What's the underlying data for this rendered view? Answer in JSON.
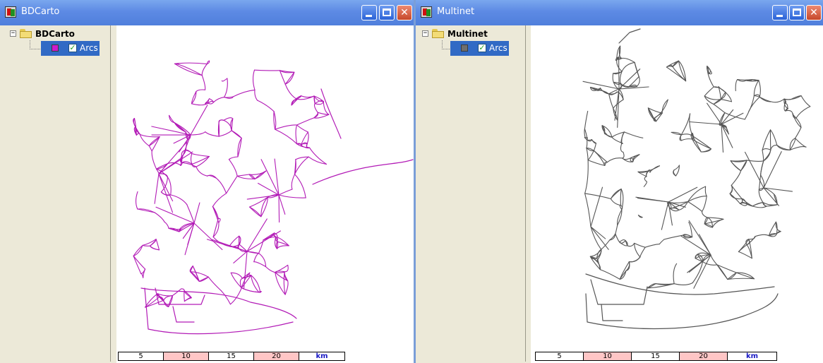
{
  "windows": [
    {
      "title": "BDCarto",
      "tree": {
        "root_label": "BDCarto",
        "root_expander": "−",
        "layer_label": "Arcs",
        "checkbox_mark": "✓"
      },
      "layer_color": "#cc1acc",
      "road_color": "#b21ab6",
      "scale": {
        "labels": [
          "5",
          "10",
          "15",
          "20"
        ],
        "unit": "km"
      }
    },
    {
      "title": "Multinet",
      "tree": {
        "root_label": "Multinet",
        "root_expander": "−",
        "layer_label": "Arcs",
        "checkbox_mark": "✓"
      },
      "layer_color": "#6e6e6e",
      "road_color": "#555555",
      "scale": {
        "labels": [
          "5",
          "10",
          "15",
          "20"
        ],
        "unit": "km"
      }
    }
  ],
  "title_buttons": {
    "minimize_icon": "minimize-icon",
    "maximize_icon": "maximize-icon",
    "close_icon": "close-icon",
    "close_glyph": "✕"
  },
  "colors": {
    "titlebar": "#5d8ae4",
    "selection": "#316ac5",
    "scale_highlight": "#ffc6c6",
    "scale_unit": "#1a1ac4"
  }
}
